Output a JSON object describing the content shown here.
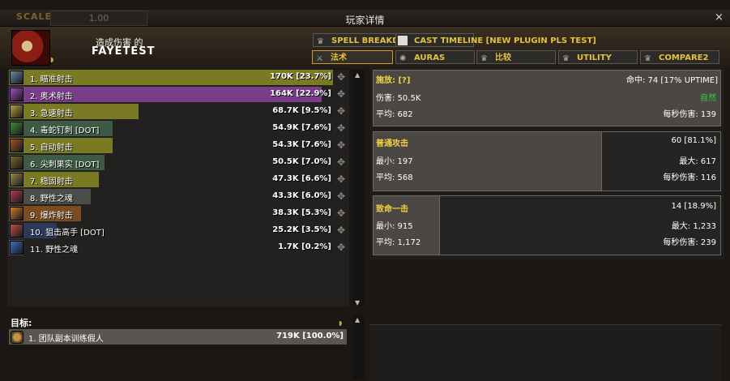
{
  "window": {
    "scale_label": "SCALE:",
    "scale_value": "1.00",
    "title": "玩家详情",
    "close": "×"
  },
  "player": {
    "header_label": "造成伤害 的",
    "name": "FAYETEST"
  },
  "top_tabs": [
    {
      "label": "SPELL BREAKDOWN",
      "icon": "crown-icon"
    },
    {
      "label": "CAST TIMELINE [NEW PLUGIN PLS TEST]",
      "icon": "plugin-icon"
    }
  ],
  "sub_tabs": [
    {
      "label": "法术",
      "icon": "swords-icon"
    },
    {
      "label": "AURAS",
      "icon": "aura-icon"
    },
    {
      "label": "比较",
      "icon": "crown-icon"
    },
    {
      "label": "UTILITY",
      "icon": "crown-icon"
    },
    {
      "label": "COMPARE2",
      "icon": "crown-icon"
    }
  ],
  "spells": [
    {
      "name": "1. 瞄准射击",
      "amount": "170K [23.7%]",
      "percent": 23.7,
      "color": "#7a7a25",
      "icon_color": "#6a87a8"
    },
    {
      "name": "2. 奥术射击",
      "amount": "164K [22.9%]",
      "percent": 22.9,
      "color": "#7a3d8a",
      "icon_color": "#9c4fbf"
    },
    {
      "name": "3. 急速射击",
      "amount": "68.7K [9.5%]",
      "percent": 9.5,
      "color": "#7a7a25",
      "icon_color": "#b6a341"
    },
    {
      "name": "4. 毒蛇钉刺 [DOT]",
      "amount": "54.9K [7.6%]",
      "percent": 7.6,
      "color": "#3d5a45",
      "icon_color": "#3e8c3a"
    },
    {
      "name": "5. 自动射击",
      "amount": "54.3K [7.6%]",
      "percent": 7.6,
      "color": "#7a7a25",
      "icon_color": "#a2542b"
    },
    {
      "name": "6. 尖刺果实 [DOT]",
      "amount": "50.5K [7.0%]",
      "percent": 7.0,
      "color": "#3d5a45",
      "icon_color": "#7d6a2a"
    },
    {
      "name": "7. 稳固射击",
      "amount": "47.3K [6.6%]",
      "percent": 6.6,
      "color": "#7a7a25",
      "icon_color": "#9c8a4f"
    },
    {
      "name": "8. 野性之魂",
      "amount": "43.3K [6.0%]",
      "percent": 6.0,
      "color": "#4a4d4a",
      "icon_color": "#b63b4f"
    },
    {
      "name": "9. 爆炸射击",
      "amount": "38.3K [5.3%]",
      "percent": 5.3,
      "color": "#7a4d20",
      "icon_color": "#d07a2a"
    },
    {
      "name": "10. 狙击高手 [DOT]",
      "amount": "25.2K [3.5%]",
      "percent": 3.5,
      "color": "#2a3a5a",
      "icon_color": "#c05040"
    },
    {
      "name": "11. 野性之魂",
      "amount": "1.7K [0.2%]",
      "percent": 0.2,
      "color": "#4a4d4a",
      "icon_color": "#3d6ec0"
    }
  ],
  "targets": {
    "label": "目标:",
    "rows": [
      {
        "name": "1. 团队副本训练假人",
        "amount": "719K [100.0%]"
      }
    ]
  },
  "details": {
    "cast": {
      "title": "施放: [?]",
      "hits": "命中: 74 [17% UPTIME]",
      "damage": "伤害: 50.5K",
      "average": "平均: 682",
      "school": "自然",
      "dps": "每秒伤害: 139"
    },
    "normal": {
      "title": "普通攻击",
      "count": "60 [81.1%]",
      "min": "最小: 197",
      "max": "最大: 617",
      "average": "平均: 568",
      "dps": "每秒伤害: 116",
      "fill_percent": 81.1
    },
    "crit": {
      "title": "致命一击",
      "count": "14 [18.9%]",
      "min": "最小: 915",
      "max": "最大: 1,233",
      "average": "平均: 1,172",
      "dps": "每秒伤害: 239",
      "fill_percent": 18.9
    }
  }
}
